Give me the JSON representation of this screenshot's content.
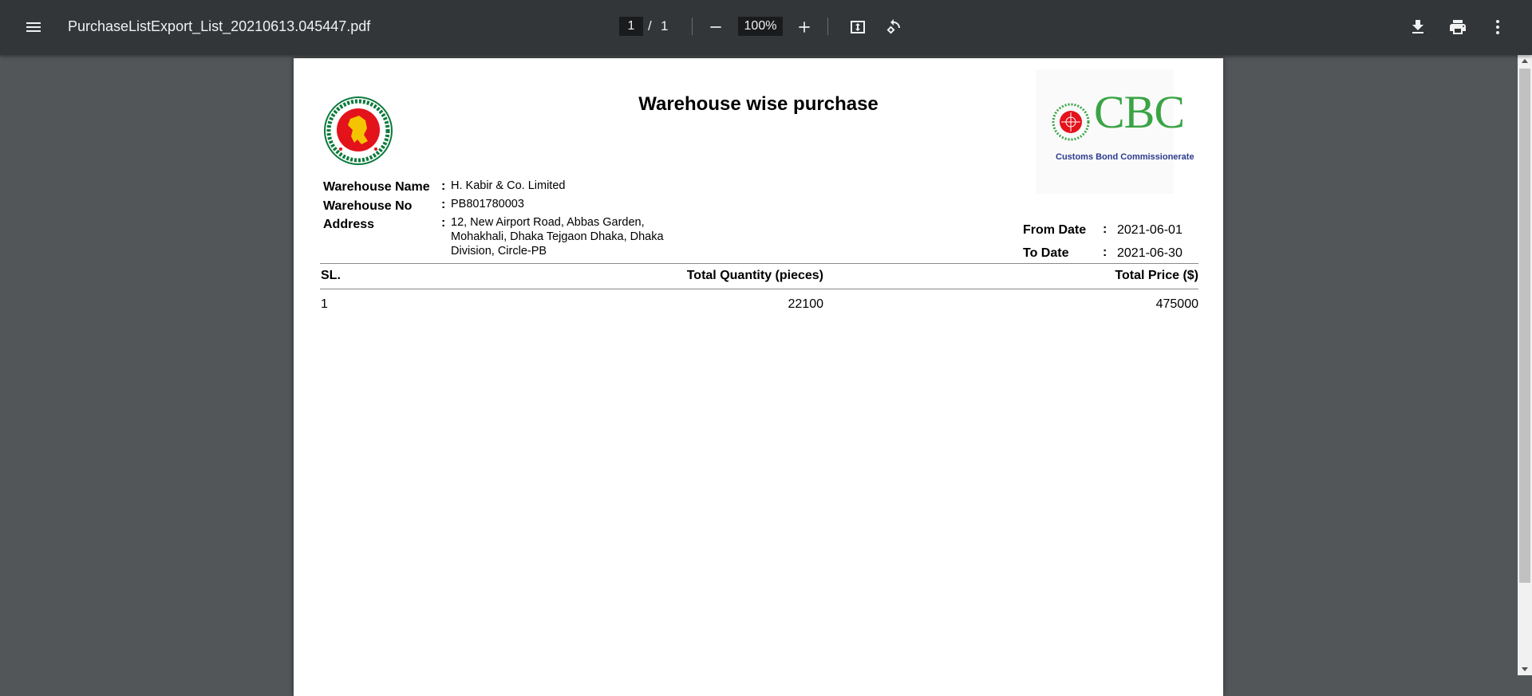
{
  "viewer": {
    "file_name": "PurchaseListExport_List_20210613.045447.pdf",
    "page_current": "1",
    "page_separator": "/",
    "page_total": "1",
    "zoom": "100%",
    "icons": [
      "menu-icon",
      "zoom-out-icon",
      "zoom-in-icon",
      "fit-page-icon",
      "rotate-icon",
      "download-icon",
      "print-icon",
      "more-vert-icon"
    ]
  },
  "report": {
    "title": "Warehouse wise purchase",
    "logo_text": "CBC",
    "logo_subtitle": "Customs Bond Commissionerate",
    "warehouse_name_label": "Warehouse Name",
    "warehouse_name": "H. Kabir & Co. Limited",
    "warehouse_no_label": "Warehouse No",
    "warehouse_no": "PB801780003",
    "address_label": "Address",
    "address": "12, New Airport Road, Abbas Garden, Mohakhali, Dhaka Tejgaon Dhaka, Dhaka Division, Circle-PB",
    "from_date_label": "From Date",
    "from_date": "2021-06-01",
    "to_date_label": "To Date",
    "to_date": "2021-06-30",
    "colon": ":",
    "table": {
      "headers": [
        "SL.",
        "Total Quantity (pieces)",
        "Total Price ($)"
      ],
      "rows": [
        [
          "1",
          "22100",
          "475000"
        ]
      ]
    }
  },
  "colors": {
    "toolbar_bg": "#323639",
    "viewer_bg": "#525659",
    "logo_green": "#3aa444",
    "logo_blue": "#2d3b8f",
    "seal_red": "#e3121b",
    "seal_green": "#0b7a3b"
  }
}
